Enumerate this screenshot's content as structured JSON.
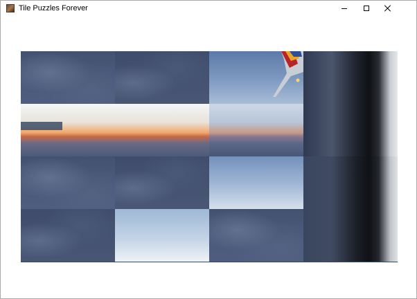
{
  "window": {
    "title": "Tile Puzzles Forever",
    "controls": {
      "minimize": "minimize-icon",
      "maximize": "maximize-icon",
      "close": "close-icon"
    }
  },
  "puzzle": {
    "rows": 4,
    "columns": 4,
    "empty_slot": {
      "row": 2,
      "column": 4
    },
    "colors": {
      "board_background": "#3a4760",
      "window_background": "#ffffff"
    }
  }
}
